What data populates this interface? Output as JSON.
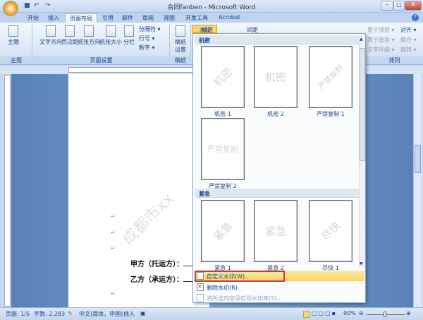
{
  "window": {
    "title": "合同fanben - Microsoft Word",
    "controls": [
      "–",
      "□",
      "X"
    ]
  },
  "tabs": [
    "开始",
    "插入",
    "页面布局",
    "引用",
    "邮件",
    "审阅",
    "视图",
    "开发工具",
    "Acrobat"
  ],
  "active_tab": "页面布局",
  "ribbon": {
    "theme_group": {
      "label": "主题",
      "button": "主题"
    },
    "page_setup_group": {
      "label": "页面设置",
      "buttons": [
        "文字方向",
        "页边距",
        "纸张方向",
        "纸张大小",
        "分栏"
      ],
      "small": [
        "分隔符 ▾",
        "行号 ▾",
        "断字 ▾"
      ]
    },
    "draft_group": {
      "label": "稿纸",
      "button": "稿纸\n设置"
    },
    "watermark_button": "水印 ▾",
    "indent": "缩进",
    "spacing": "间距",
    "arrange_group": {
      "label": "排列",
      "items": [
        "置于顶层 ▾",
        "置于底层 ▾",
        "文字环绕 ▾",
        "对齐 ▾",
        "组合 ▾",
        "旋转 ▾"
      ]
    }
  },
  "watermark_menu": {
    "sections": [
      {
        "title": "机密",
        "items": [
          {
            "label": "机密 1",
            "text": "机密",
            "style": "diagonal"
          },
          {
            "label": "机密 2",
            "text": "机密",
            "style": "horizontal"
          },
          {
            "label": "严禁复制 1",
            "text": "严禁复制",
            "style": "diagonal"
          },
          {
            "label": "严禁复制 2",
            "text": "严禁复制",
            "style": "horizontal"
          }
        ]
      },
      {
        "title": "紧急",
        "items": [
          {
            "label": "紧急 1",
            "text": "紧急",
            "style": "diagonal"
          },
          {
            "label": "紧急 2",
            "text": "紧急",
            "style": "horizontal"
          },
          {
            "label": "尽快 1",
            "text": "尽快",
            "style": "diagonal"
          }
        ]
      }
    ],
    "commands": [
      {
        "label": "自定义水印(W)...",
        "highlighted": true
      },
      {
        "label": "删除水印(R)",
        "highlighted": false
      },
      {
        "label": "将所选内容保存到水印库(S)...",
        "disabled": true
      }
    ]
  },
  "document": {
    "watermark": "成都市xx",
    "party_a": "甲方（托运方）：",
    "party_b": "乙方（承运方）：",
    "para_mark": "↵"
  },
  "status": {
    "page": "页面: 1/5",
    "words": "字数: 2,283",
    "language": "中文(简体，中国)",
    "mode": "插入",
    "zoom": "90%"
  },
  "colors": {
    "highlight": "#fbd56a",
    "callout": "#e03030"
  }
}
